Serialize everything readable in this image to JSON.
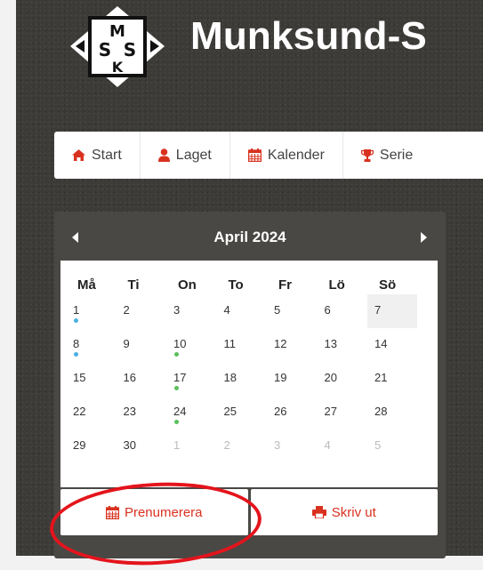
{
  "site": {
    "title": "Munksund-S",
    "logo_text": "MSSK"
  },
  "nav": {
    "items": [
      {
        "label": "Start",
        "icon": "home-icon"
      },
      {
        "label": "Laget",
        "icon": "user-icon"
      },
      {
        "label": "Kalender",
        "icon": "calendar-icon"
      },
      {
        "label": "Serie",
        "icon": "trophy-icon"
      }
    ]
  },
  "calendar": {
    "month_label": "April 2024",
    "weekdays": [
      "Må",
      "Ti",
      "On",
      "To",
      "Fr",
      "Lö",
      "Sö"
    ],
    "weeks": [
      [
        "1",
        "2",
        "3",
        "4",
        "5",
        "6",
        "7"
      ],
      [
        "8",
        "9",
        "10",
        "11",
        "12",
        "13",
        "14"
      ],
      [
        "15",
        "16",
        "17",
        "18",
        "19",
        "20",
        "21"
      ],
      [
        "22",
        "23",
        "24",
        "25",
        "26",
        "27",
        "28"
      ],
      [
        "29",
        "30",
        "1",
        "2",
        "3",
        "4",
        "5"
      ]
    ],
    "today": "7",
    "event_dots": [
      {
        "day": "1",
        "color": "blue"
      },
      {
        "day": "8",
        "color": "blue"
      },
      {
        "day": "10",
        "color": "green"
      },
      {
        "day": "17",
        "color": "green"
      },
      {
        "day": "24",
        "color": "green"
      }
    ],
    "subscribe_label": "Prenumerera",
    "print_label": "Skriv ut"
  },
  "colors": {
    "accent_red": "#d9311f",
    "annotation_red": "#e4141c",
    "dot_blue": "#4ab0e0",
    "dot_green": "#5cbf5c"
  }
}
